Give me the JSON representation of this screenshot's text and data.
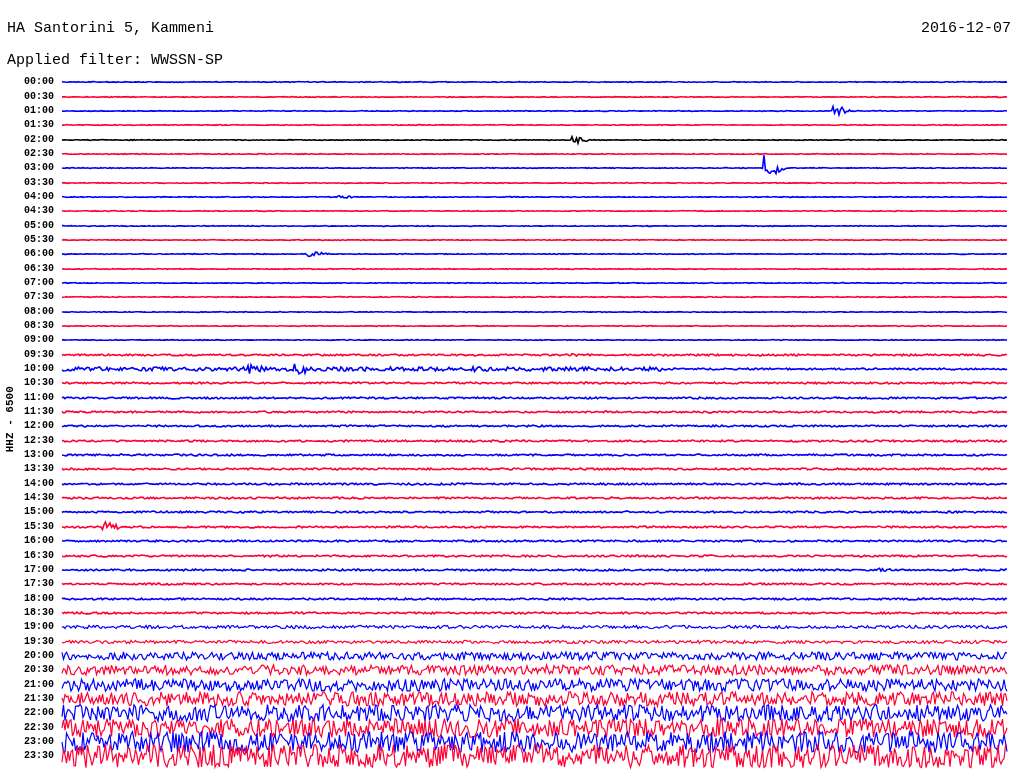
{
  "header": {
    "station": "HA Santorini 5, Kammeni",
    "date": "2016-12-07",
    "filter": "Applied filter: WWSSN-SP"
  },
  "axis_label": "HHZ - 6500",
  "traces": [
    {
      "time": "00:00",
      "color": "#0000ff"
    },
    {
      "time": "00:30",
      "color": "#ff0033"
    },
    {
      "time": "01:00",
      "color": "#0000ff"
    },
    {
      "time": "01:30",
      "color": "#ff0033"
    },
    {
      "time": "02:00",
      "color": "#000000"
    },
    {
      "time": "02:30",
      "color": "#ff0033"
    },
    {
      "time": "03:00",
      "color": "#0000ff"
    },
    {
      "time": "03:30",
      "color": "#ff0033"
    },
    {
      "time": "04:00",
      "color": "#0000ff"
    },
    {
      "time": "04:30",
      "color": "#ff0033"
    },
    {
      "time": "05:00",
      "color": "#0000ff"
    },
    {
      "time": "05:30",
      "color": "#ff0033"
    },
    {
      "time": "06:00",
      "color": "#0000ff"
    },
    {
      "time": "06:30",
      "color": "#ff0033"
    },
    {
      "time": "07:00",
      "color": "#0000ff"
    },
    {
      "time": "07:30",
      "color": "#ff0033"
    },
    {
      "time": "08:00",
      "color": "#0000ff"
    },
    {
      "time": "08:30",
      "color": "#ff0033"
    },
    {
      "time": "09:00",
      "color": "#0000ff"
    },
    {
      "time": "09:30",
      "color": "#ff0033"
    },
    {
      "time": "10:00",
      "color": "#0000ff"
    },
    {
      "time": "10:30",
      "color": "#ff0033"
    },
    {
      "time": "11:00",
      "color": "#0000ff"
    },
    {
      "time": "11:30",
      "color": "#ff0033"
    },
    {
      "time": "12:00",
      "color": "#0000ff"
    },
    {
      "time": "12:30",
      "color": "#ff0033"
    },
    {
      "time": "13:00",
      "color": "#0000ff"
    },
    {
      "time": "13:30",
      "color": "#ff0033"
    },
    {
      "time": "14:00",
      "color": "#0000ff"
    },
    {
      "time": "14:30",
      "color": "#ff0033"
    },
    {
      "time": "15:00",
      "color": "#0000ff"
    },
    {
      "time": "15:30",
      "color": "#ff0033"
    },
    {
      "time": "16:00",
      "color": "#0000ff"
    },
    {
      "time": "16:30",
      "color": "#ff0033"
    },
    {
      "time": "17:00",
      "color": "#0000ff"
    },
    {
      "time": "17:30",
      "color": "#ff0033"
    },
    {
      "time": "18:00",
      "color": "#0000ff"
    },
    {
      "time": "18:30",
      "color": "#ff0033"
    },
    {
      "time": "19:00",
      "color": "#0000ff"
    },
    {
      "time": "19:30",
      "color": "#ff0033"
    },
    {
      "time": "20:00",
      "color": "#0000ff"
    },
    {
      "time": "20:30",
      "color": "#ff0033"
    },
    {
      "time": "21:00",
      "color": "#0000ff"
    },
    {
      "time": "21:30",
      "color": "#ff0033"
    },
    {
      "time": "22:00",
      "color": "#0000ff"
    },
    {
      "time": "22:30",
      "color": "#ff0033"
    },
    {
      "time": "23:00",
      "color": "#0000ff"
    },
    {
      "time": "23:30",
      "color": "#ff0033"
    }
  ]
}
